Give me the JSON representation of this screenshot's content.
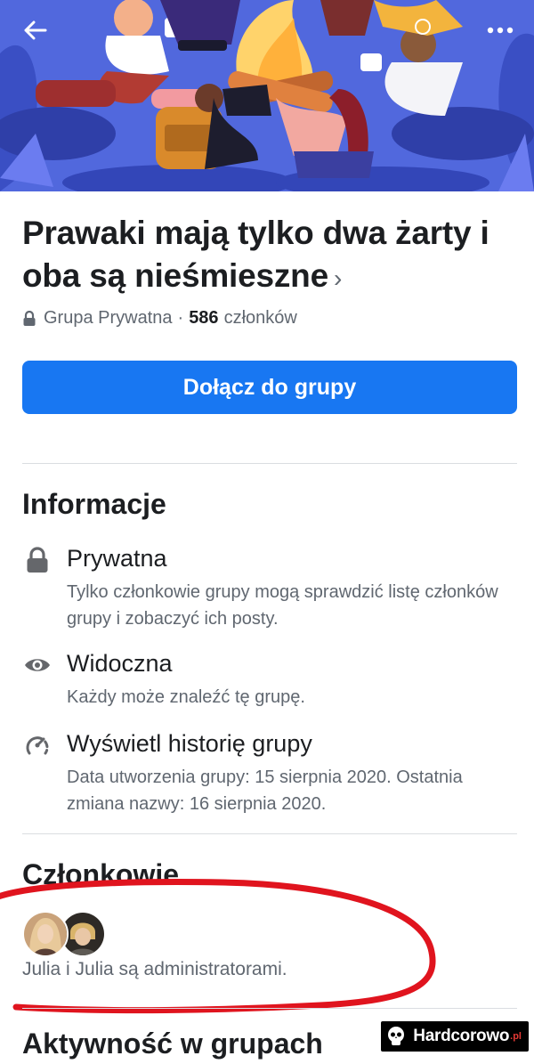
{
  "group": {
    "name": "Prawaki mają tylko dwa żarty i oba są nieśmieszne",
    "chevron": "›",
    "privacy": "Grupa Prywatna",
    "separator": "·",
    "member_count": "586",
    "member_word": "członków"
  },
  "join_button_label": "Dołącz do grupy",
  "about": {
    "heading": "Informacje",
    "items": [
      {
        "icon": "lock-icon",
        "title": "Prywatna",
        "description": "Tylko członkowie grupy mogą sprawdzić listę członków grupy i zobaczyć ich posty."
      },
      {
        "icon": "eye-icon",
        "title": "Widoczna",
        "description": "Każdy może znaleźć tę grupę."
      },
      {
        "icon": "history-icon",
        "title": "Wyświetl historię grupy",
        "description": "Data utworzenia grupy: 15 sierpnia 2020. Ostatnia zmiana nazwy: 16 sierpnia 2020."
      }
    ]
  },
  "members": {
    "heading": "Członkowie",
    "admins_text": "Julia i Julia są administratorami."
  },
  "activity_heading": "Aktywność w grupach",
  "watermark": {
    "text": "Hardcorowo",
    "tld": ".pl"
  },
  "colors": {
    "accent": "#1877f2",
    "annotation": "#e0141e",
    "cover": "#4a63d8"
  }
}
